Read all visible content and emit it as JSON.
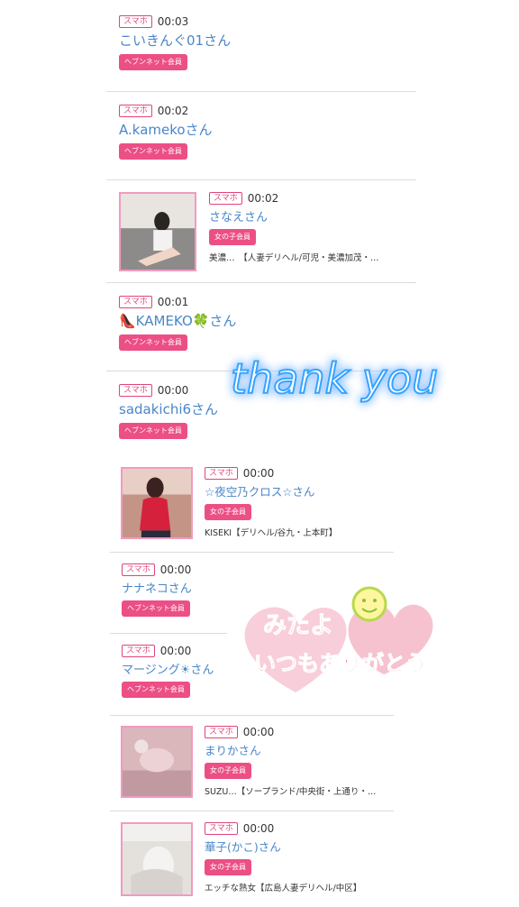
{
  "entries": [
    {
      "device": "スマホ",
      "time": "00:03",
      "name": "こいきんぐ01さん",
      "badge": "ヘブンネット会員"
    },
    {
      "device": "スマホ",
      "time": "00:02",
      "name": "A.kamekoさん",
      "badge": "ヘブンネット会員"
    },
    {
      "device": "スマホ",
      "time": "00:02",
      "name": "さなえさん",
      "badge": "女の子会員",
      "shop": "美濃…　【人妻デリヘル/可児・美濃加茂・…"
    },
    {
      "device": "スマホ",
      "time": "00:01",
      "name": "👠KAMEKO🍀さん",
      "badge": "ヘブンネット会員"
    },
    {
      "device": "スマホ",
      "time": "00:00",
      "name": "sadakichi6さん",
      "badge": "ヘブンネット会員"
    },
    {
      "device": "スマホ",
      "time": "00:00",
      "name": "☆夜空乃クロス☆さん",
      "badge": "女の子会員",
      "shop": "KISEKI【デリヘル/谷九・上本町】"
    },
    {
      "device": "スマホ",
      "time": "00:00",
      "name": "ナナネコさん",
      "badge": "ヘブンネット会員"
    },
    {
      "device": "スマホ",
      "time": "00:00",
      "name": "マージング☀さん",
      "badge": "ヘブンネット会員"
    },
    {
      "device": "スマホ",
      "time": "00:00",
      "name": "まりかさん",
      "badge": "女の子会員",
      "shop": "SUZU…【ソープランド/中央街・上通り・…"
    },
    {
      "device": "スマホ",
      "time": "00:00",
      "name": "華子(かこ)さん",
      "badge": "女の子会員",
      "shop": "エッチな熟女【広島人妻デリヘル/中区】"
    }
  ],
  "overlays": {
    "thank_you": "thank you",
    "message_line1": "みたよ",
    "message_line2": "いつもありがとう"
  },
  "colors": {
    "name_blue": "#4a86c8",
    "badge_pink": "#ec4f85",
    "glow_blue": "#36a4ff"
  }
}
